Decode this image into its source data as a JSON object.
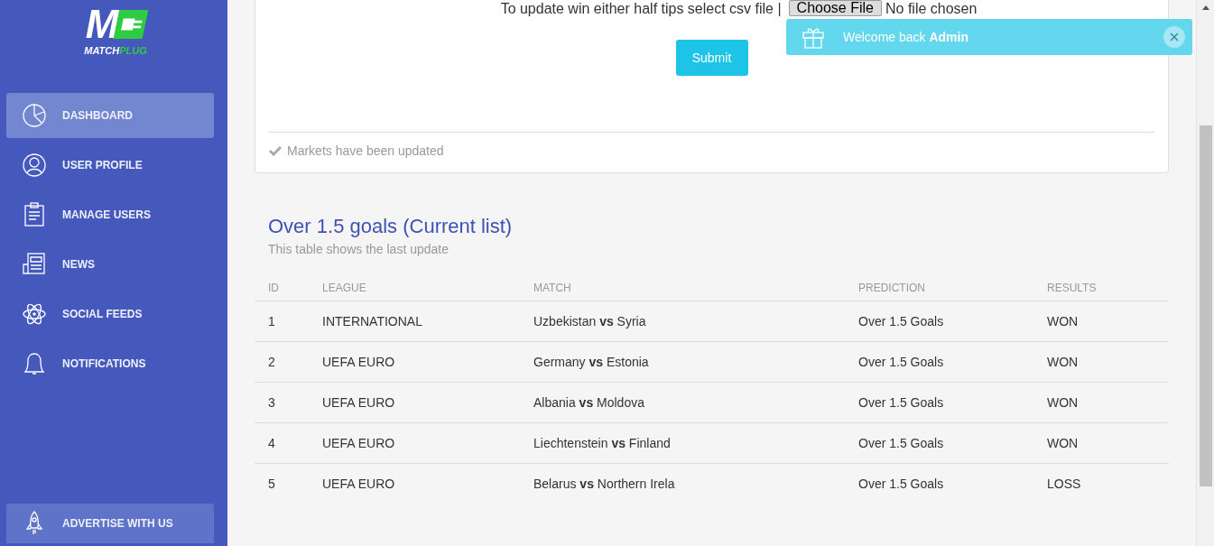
{
  "sidebar": {
    "logo": {
      "mark": "M",
      "brand_a": "MATCH",
      "brand_b": "PLUG"
    },
    "items": [
      {
        "label": "DASHBOARD",
        "selected": true
      },
      {
        "label": "USER PROFILE",
        "selected": false
      },
      {
        "label": "MANAGE USERS",
        "selected": false
      },
      {
        "label": "NEWS",
        "selected": false
      },
      {
        "label": "SOCIAL FEEDS",
        "selected": false
      },
      {
        "label": "NOTIFICATIONS",
        "selected": false
      }
    ],
    "footer_button": {
      "label": "ADVERTISE WITH US"
    }
  },
  "upload_card": {
    "prompt": "To update win either half tips select csv file |",
    "file_button": "Choose File",
    "file_status": "No file chosen",
    "submit": "Submit",
    "footer": "Markets have been updated"
  },
  "table_section": {
    "title": "Over 1.5 goals (Current list)",
    "subtitle": "This table shows the last update",
    "columns": [
      "ID",
      "LEAGUE",
      "MATCH",
      "PREDICTION",
      "RESULTS"
    ],
    "rows": [
      {
        "id": "1",
        "league": "INTERNATIONAL",
        "match": "Uzbekistan **vs** Syria",
        "prediction": "Over 1.5 Goals",
        "result": "WON"
      },
      {
        "id": "2",
        "league": "UEFA EURO",
        "match": "Germany **vs** Estonia",
        "prediction": "Over 1.5 Goals",
        "result": "WON"
      },
      {
        "id": "3",
        "league": "UEFA EURO",
        "match": "Albania **vs** Moldova",
        "prediction": "Over 1.5 Goals",
        "result": "WON"
      },
      {
        "id": "4",
        "league": "UEFA EURO",
        "match": "Liechtenstein **vs** Finland",
        "prediction": "Over 1.5 Goals",
        "result": "WON"
      },
      {
        "id": "5",
        "league": "UEFA EURO",
        "match": "Belarus **vs** Northern Irela",
        "prediction": "Over 1.5 Goals",
        "result": "LOSS"
      }
    ]
  },
  "toast": {
    "message": "Welcome back **Admin**"
  }
}
